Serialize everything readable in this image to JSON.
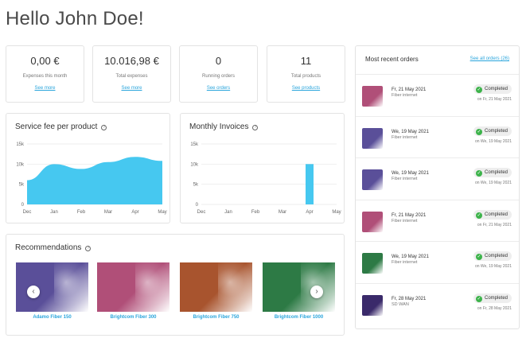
{
  "greeting": "Hello John Doe!",
  "stats": [
    {
      "value": "0,00 €",
      "label": "Expenses this month",
      "link": "See more"
    },
    {
      "value": "10.016,98 €",
      "label": "Total expenses",
      "link": "See more"
    },
    {
      "value": "0",
      "label": "Running orders",
      "link": "See orders"
    },
    {
      "value": "11",
      "label": "Total products",
      "link": "See products"
    }
  ],
  "help_glyph": "?",
  "service_chart": {
    "title": "Service fee per product",
    "chart_data": {
      "type": "area",
      "categories": [
        "Dec",
        "Jan",
        "Feb",
        "Mar",
        "Apr",
        "May"
      ],
      "values": [
        6000,
        10000,
        8800,
        10500,
        11800,
        10800
      ],
      "y_ticks": [
        "0",
        "5k",
        "10k",
        "15k"
      ],
      "ylim": [
        0,
        15000
      ],
      "color": "#46c8f0",
      "grid": true
    }
  },
  "invoice_chart": {
    "title": "Monthly Invoices",
    "chart_data": {
      "type": "bar",
      "categories": [
        "Dec",
        "Jan",
        "Feb",
        "Mar",
        "Apr",
        "May"
      ],
      "values": [
        0,
        0,
        0,
        0,
        10000,
        0
      ],
      "y_ticks": [
        "0",
        "5k",
        "10k",
        "15k"
      ],
      "ylim": [
        0,
        15000
      ],
      "color": "#46c8f0",
      "grid": true
    }
  },
  "recommendations": {
    "title": "Recommendations",
    "prev_glyph": "‹",
    "next_glyph": "›",
    "items": [
      {
        "name": "Adamo Fiber 150",
        "color": "#5a4f99"
      },
      {
        "name": "Brightcom Fiber 300",
        "color": "#b04f78"
      },
      {
        "name": "Brightcom Fiber 750",
        "color": "#a8542e"
      },
      {
        "name": "Brightcom Fiber 1000",
        "color": "#2d7a45"
      }
    ]
  },
  "orders": {
    "title": "Most recent orders",
    "see_all": "See all orders (26)",
    "check_glyph": "✓",
    "items": [
      {
        "date": "Fr, 21 May 2021",
        "product": "Fiber internet",
        "status": "Completed",
        "completed_on": "on Fr, 21 May 2021",
        "color": "#b04f78"
      },
      {
        "date": "We, 19 May 2021",
        "product": "Fiber internet",
        "status": "Completed",
        "completed_on": "on We, 19 May 2021",
        "color": "#5a4f99"
      },
      {
        "date": "We, 19 May 2021",
        "product": "Fiber internet",
        "status": "Completed",
        "completed_on": "on We, 19 May 2021",
        "color": "#5a4f99"
      },
      {
        "date": "Fr, 21 May 2021",
        "product": "Fiber internet",
        "status": "Completed",
        "completed_on": "on Fr, 21 May 2021",
        "color": "#b04f78"
      },
      {
        "date": "We, 19 May 2021",
        "product": "Fiber internet",
        "status": "Completed",
        "completed_on": "on We, 19 May 2021",
        "color": "#2d7a45"
      },
      {
        "date": "Fr, 28 May 2021",
        "product": "SD WAN",
        "status": "Completed",
        "completed_on": "on Fr, 28 May 2021",
        "color": "#3a2a6a"
      }
    ]
  }
}
